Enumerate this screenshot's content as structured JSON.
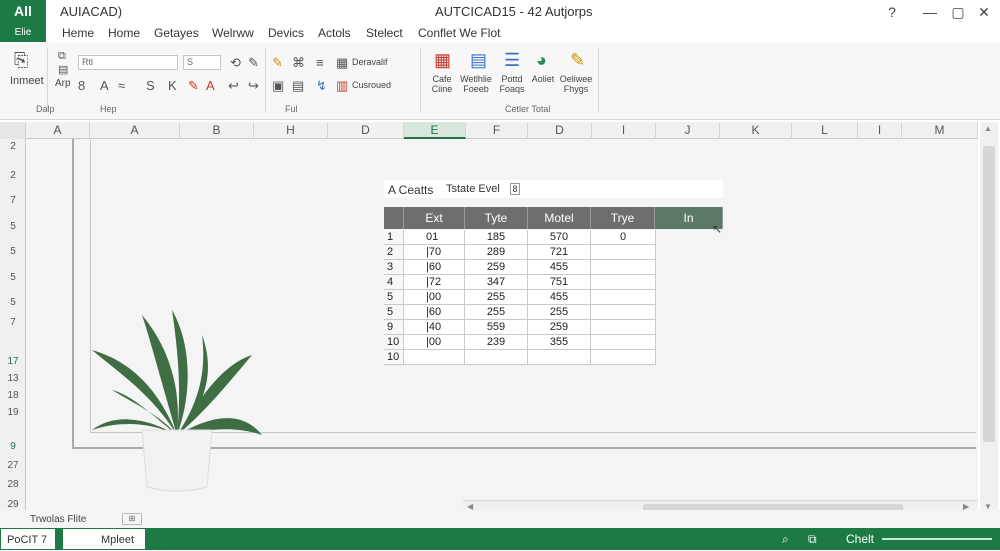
{
  "title_bar": {
    "app_badge": "All",
    "file_label": "Elie",
    "app_title": "AUIACAD)",
    "doc_title": "AUTCICAD15 - 42 Autjorps",
    "buttons": [
      "?",
      "—",
      "▢",
      "✕"
    ]
  },
  "menu_tabs": [
    "Heme",
    "Home",
    "Getayes",
    "Welrww",
    "Devics",
    "Actols",
    "Stelect",
    "Conflet We Flot"
  ],
  "ribbon": {
    "insert_label": "Inmeet",
    "app_label": "Arp",
    "font_box": "Rtl",
    "size_box": "S",
    "small_icons_row1": [
      "⟲",
      "✎",
      "↩",
      "↪"
    ],
    "small_icons_row2": [
      "8",
      "A",
      "≈",
      "S",
      "K"
    ],
    "layout_items": [
      "Deravalif",
      "Cusroued"
    ],
    "big_buttons": [
      {
        "label": "Cafe\nCiine",
        "icon": "table-icon"
      },
      {
        "label": "Wetlhlie\nFoeeb",
        "icon": "grid-icon"
      },
      {
        "label": "Pottd\nFoaqs",
        "icon": "list-icon"
      },
      {
        "label": "Aoliet",
        "icon": "pie-chart-icon"
      },
      {
        "label": "Oeliwee\nFhygs",
        "icon": "pencil-icon"
      }
    ],
    "groups": [
      "Dalp",
      "Hep",
      "Ful",
      "Cetler Total"
    ]
  },
  "columns": [
    "A",
    "A",
    "B",
    "H",
    "D",
    "E",
    "F",
    "D",
    "I",
    "J",
    "K",
    "L",
    "I",
    "M"
  ],
  "selected_column": "E",
  "rows": [
    "2",
    "2",
    "7",
    "5",
    "5",
    "5",
    "5",
    "5",
    "7",
    "17",
    "13",
    "18",
    "19",
    "9",
    "27",
    "28",
    "29"
  ],
  "table": {
    "caption": "A Ceatts",
    "filter_label": "Tstate Evel",
    "filter_toggle": "8",
    "headers": [
      "Ext",
      "Tyte",
      "Motel",
      "Trye",
      "In"
    ],
    "rows": [
      [
        "1",
        "01",
        "185",
        "570",
        "0"
      ],
      [
        "2",
        "|70",
        "289",
        "721",
        ""
      ],
      [
        "3",
        "|60",
        "259",
        "455",
        ""
      ],
      [
        "4",
        "|72",
        "347",
        "751",
        ""
      ],
      [
        "5",
        "|00",
        "255",
        "455",
        ""
      ],
      [
        "5",
        "|60",
        "255",
        "255",
        ""
      ],
      [
        "9",
        "|40",
        "559",
        "259",
        ""
      ],
      [
        "10",
        "|00",
        "239",
        "355",
        ""
      ],
      [
        "10",
        "",
        "",
        "",
        ""
      ]
    ]
  },
  "sheet_tabs": {
    "label": "Trwolas Flite"
  },
  "status_bar": {
    "left": "PoCIT 7",
    "sheet": "Mpleet",
    "right": "Chelt"
  },
  "colors": {
    "excel_green": "#1e7a45",
    "header_dark": "#6e6e6e"
  }
}
